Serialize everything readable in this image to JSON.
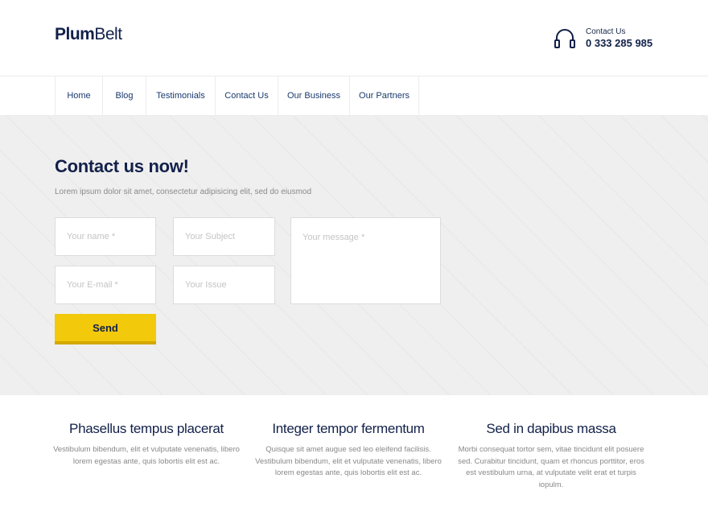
{
  "brand": {
    "bold": "Plum",
    "light": "Belt"
  },
  "contact": {
    "label": "Contact Us",
    "phone": "0 333 285 985",
    "icon": "headphones-icon"
  },
  "nav": {
    "items": [
      "Home",
      "Blog",
      "Testimonials",
      "Contact Us",
      "Our Business",
      "Our Partners"
    ]
  },
  "hero": {
    "title": "Contact us now!",
    "lead": "Lorem ipsum dolor sit amet, consectetur adipisicing elit, sed do eiusmod"
  },
  "form": {
    "name_placeholder": "Your name *",
    "subject_placeholder": "Your Subject",
    "email_placeholder": "Your E-mail *",
    "issue_placeholder": "Your Issue",
    "message_placeholder": "Your message *",
    "send_label": "Send"
  },
  "features": [
    {
      "title": "Phasellus tempus placerat",
      "text": "Vestibulum bibendum, elit et vulputate venenatis, libero lorem egestas ante, quis lobortis elit est ac."
    },
    {
      "title": "Integer tempor fermentum",
      "text": "Quisque sit amet augue sed leo eleifend facilisis. Vestibulum bibendum, elit et vulputate venenatis, libero lorem egestas ante, quis lobortis elit est ac."
    },
    {
      "title": "Sed in dapibus massa",
      "text": "Morbi consequat tortor sem, vitae tincidunt elit posuere sed. Curabitur tincidunt, quam et rhoncus porttitor, eros est vestibulum urna, at vulputate velit erat et turpis iopulm."
    }
  ],
  "colors": {
    "accent": "#f3c90c",
    "navy": "#12214a",
    "hero_bg": "#efefef"
  }
}
